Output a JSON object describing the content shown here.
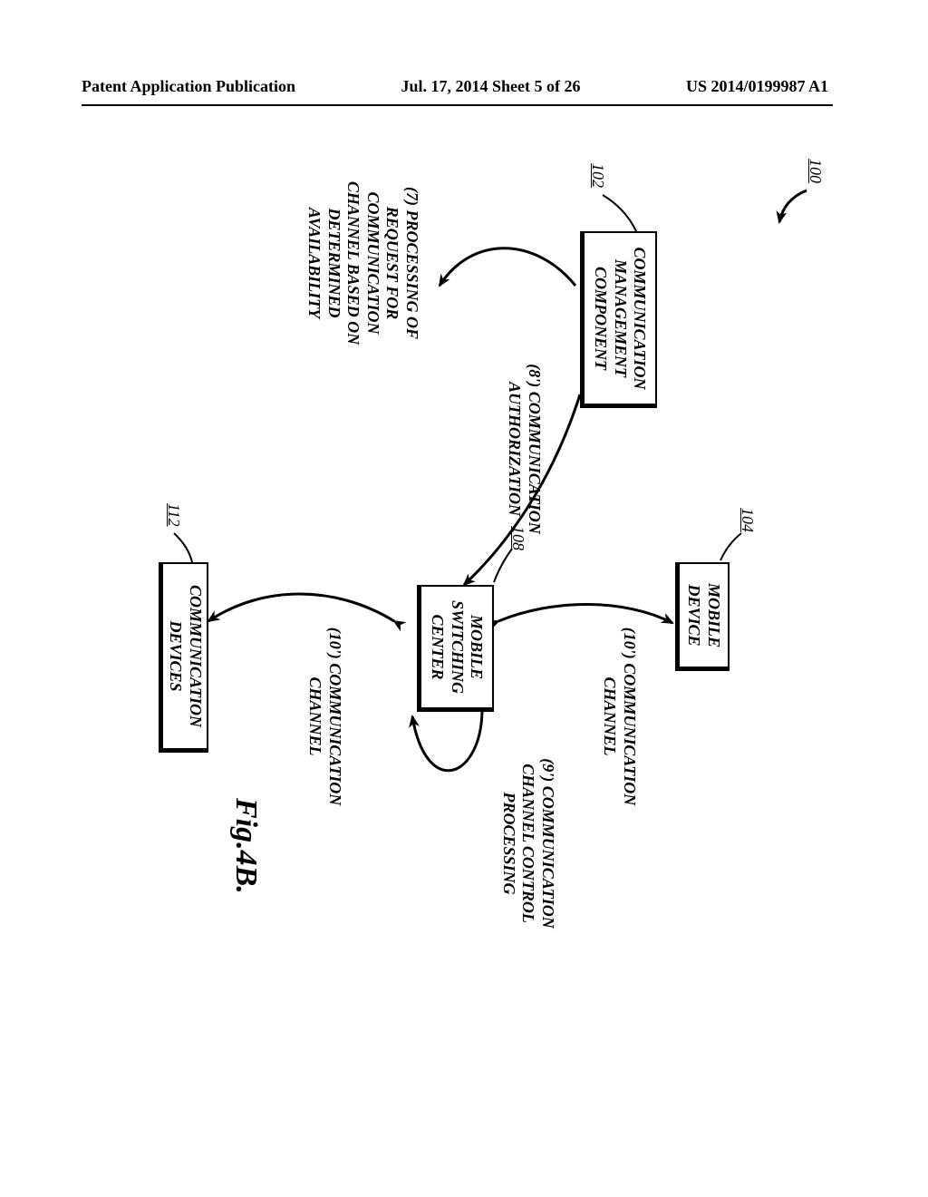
{
  "header": {
    "left": "Patent Application Publication",
    "center": "Jul. 17, 2014  Sheet 5 of 26",
    "right": "US 2014/0199987 A1"
  },
  "refs": {
    "system": "100",
    "cmc": "102",
    "mobile_device": "104",
    "msc": "108",
    "comm_devices": "112"
  },
  "boxes": {
    "cmc": "COMMUNICATION MANAGEMENT COMPONENT",
    "mobile_device": "MOBILE DEVICE",
    "msc": "MOBILE SWITCHING CENTER",
    "comm_devices": "COMMUNICATION DEVICES"
  },
  "labels": {
    "step7": "(7) PROCESSING OF REQUEST FOR COMMUNICATION CHANNEL BASED ON DETERMINED AVAILABILITY",
    "step8": "(8') COMMUNICATION AUTHORIZATION",
    "step9": "(9') COMMUNICATION CHANNEL CONTROL PROCESSING",
    "step10a": "(10') COMMUNICATION CHANNEL",
    "step10b": "(10') COMMUNICATION CHANNEL"
  },
  "figure_caption": "Fig.4B."
}
